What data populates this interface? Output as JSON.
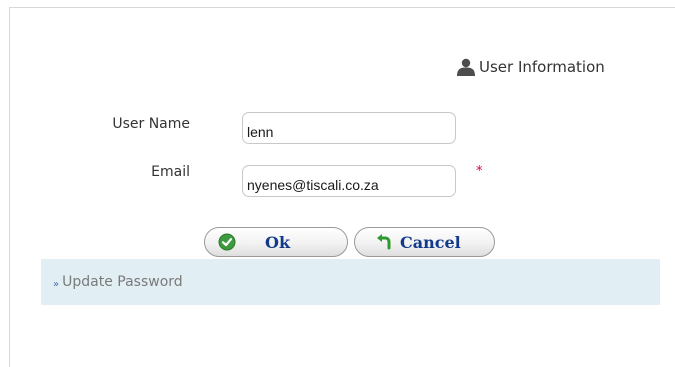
{
  "section": {
    "title": "User Information",
    "icon": "user-icon"
  },
  "form": {
    "username_label": "User Name",
    "username_value": "lenn",
    "email_label": "Email",
    "email_value": "nyenes@tiscali.co.za",
    "required_mark": "*"
  },
  "buttons": {
    "ok_label": "Ok",
    "ok_icon": "check-circle-icon",
    "cancel_label": "Cancel",
    "cancel_icon": "undo-arrow-icon"
  },
  "password": {
    "link_label": "Update Password",
    "arrow_glyph": "»"
  },
  "colors": {
    "button_text": "#123a8a",
    "required": "#d9002a",
    "password_bar": "#e1eef4"
  }
}
